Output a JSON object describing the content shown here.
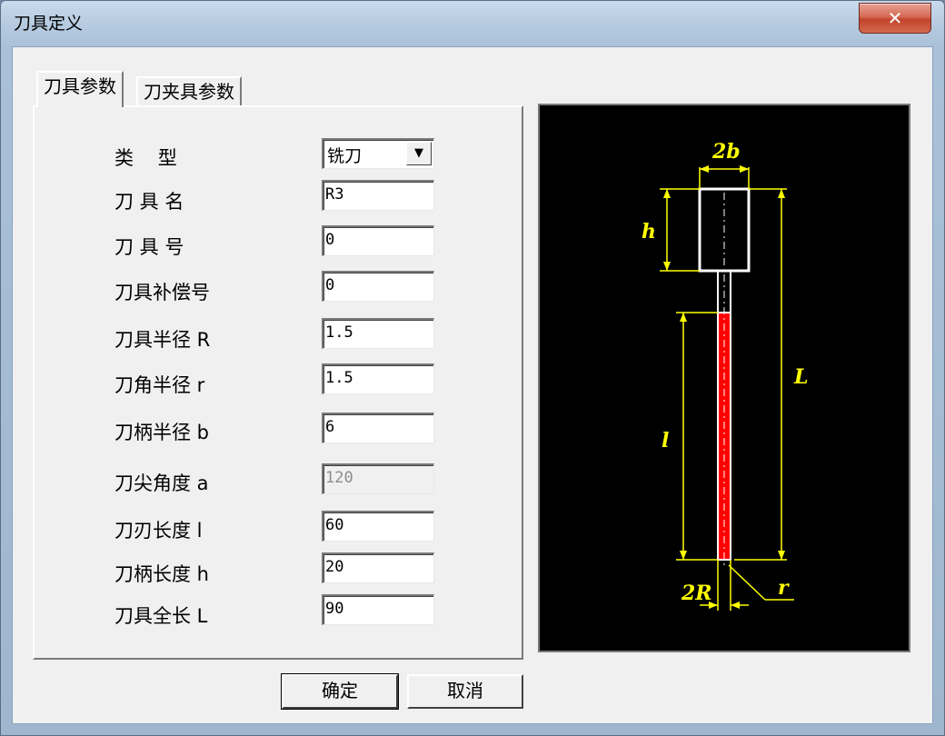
{
  "window": {
    "title": "刀具定义",
    "close_label": "✕"
  },
  "tabs": [
    {
      "label": "刀具参数",
      "active": true
    },
    {
      "label": "刀夹具参数",
      "active": false
    }
  ],
  "fields": {
    "type": {
      "label": "类    型",
      "value": "铣刀",
      "options_selected": "铣刀"
    },
    "name": {
      "label": "刀 具 名",
      "value": "R3"
    },
    "number": {
      "label": "刀 具 号",
      "value": "0"
    },
    "comp_number": {
      "label": "刀具补偿号",
      "value": "0"
    },
    "radius_R": {
      "label": "刀具半径 R",
      "value": "1.5"
    },
    "corner_r": {
      "label": "刀角半径 r",
      "value": "1.5"
    },
    "shank_b": {
      "label": "刀柄半径 b",
      "value": "6"
    },
    "tip_angle_a": {
      "label": "刀尖角度 a",
      "value": "120",
      "disabled": true
    },
    "edge_len_l": {
      "label": "刀刃长度 l",
      "value": "60"
    },
    "shank_len_h": {
      "label": "刀柄长度 h",
      "value": "20"
    },
    "total_len_L": {
      "label": "刀具全长 L",
      "value": "90"
    }
  },
  "preview": {
    "labels": {
      "shank_width": "2b",
      "shank_height": "h",
      "edge_length": "l",
      "total_length": "L",
      "diameter": "2R",
      "corner": "r"
    },
    "colors": {
      "background": "#000000",
      "outline": "#ffffff",
      "dimension": "#ffff00",
      "edge": "#ff0000"
    }
  },
  "buttons": {
    "ok": "确定",
    "cancel": "取消"
  }
}
